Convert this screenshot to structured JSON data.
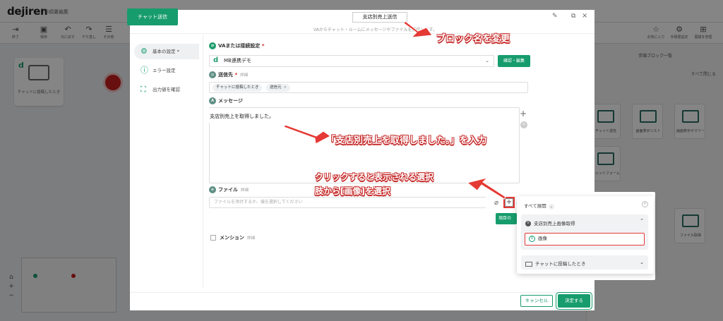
{
  "app": {
    "logo": "dejiren",
    "doc_title": "手順書編集",
    "toolbar": [
      {
        "name": "exit",
        "label": "終了",
        "icon": "exit-icon"
      },
      {
        "name": "save",
        "label": "保存",
        "icon": "save-icon"
      },
      {
        "name": "undo",
        "label": "元に戻す",
        "icon": "undo-icon"
      },
      {
        "name": "redo",
        "label": "やり直し",
        "icon": "redo-icon"
      },
      {
        "name": "other",
        "label": "その他",
        "icon": "menu-icon"
      }
    ],
    "toolbar_right": [
      {
        "name": "favorite",
        "label": "お気に入り",
        "icon": "star-icon"
      },
      {
        "name": "flow-settings",
        "label": "手順書設定",
        "icon": "settings-icon"
      },
      {
        "name": "expand-all",
        "label": "展開を管理",
        "icon": "tree-icon"
      }
    ],
    "canvas_card_label": "チャットに投稿したとき",
    "right_panel": {
      "title": "手順ブロック一覧",
      "close_label": "すべて閉じる",
      "tiles": [
        {
          "label": "チャット送信"
        },
        {
          "label": "画面表示リスト"
        },
        {
          "label": "画面表示サマリー"
        },
        {
          "label": "チャットフォーム"
        },
        {
          "label": "ファイル取得"
        }
      ]
    }
  },
  "modal": {
    "tab_label": "チャット送信",
    "block_name": "支店別売上送信",
    "header_desc": "VAからチャット・ルームにメッセージやファイルを送信します。",
    "nav": [
      {
        "label": "基本の設定 *",
        "icon": "gear-icon"
      },
      {
        "label": "エラー設定",
        "icon": "info-icon"
      },
      {
        "label": "出力値を確認",
        "icon": "output-icon"
      }
    ],
    "va_label": "VAまたは接続設定",
    "va_value": "MB連携デモ",
    "confirm_button": "確認・編集",
    "destination_label": "送信先",
    "destination_sub": "詳細",
    "destination_tags": [
      "チャットに投稿したとき",
      "送信元"
    ],
    "message_label": "メッセージ",
    "message_text": "支店別売上を取得しました。",
    "file_label": "ファイル",
    "file_sub": "詳細",
    "file_placeholder": "ファイルを添付するか、値を選択してください",
    "mention_label": "メンション",
    "mention_sub": "詳細",
    "cancel_button": "キャンセル",
    "ok_button": "決定する"
  },
  "popup": {
    "item_button": "項目の",
    "expand_all": "すべて展開",
    "group1_title": "支店別売上画像取得",
    "group1_option": "画像",
    "group2_title": "チャットに投稿したとき"
  },
  "annotations": {
    "rename": "ブロック名を変更",
    "input": "「支店別売上を取得しました。」を入力",
    "select_line1": "クリックすると表示される選択",
    "select_line2": "肢から[画像]を選択"
  },
  "colors": {
    "accent": "#179c6d",
    "annotation": "#e53935"
  }
}
